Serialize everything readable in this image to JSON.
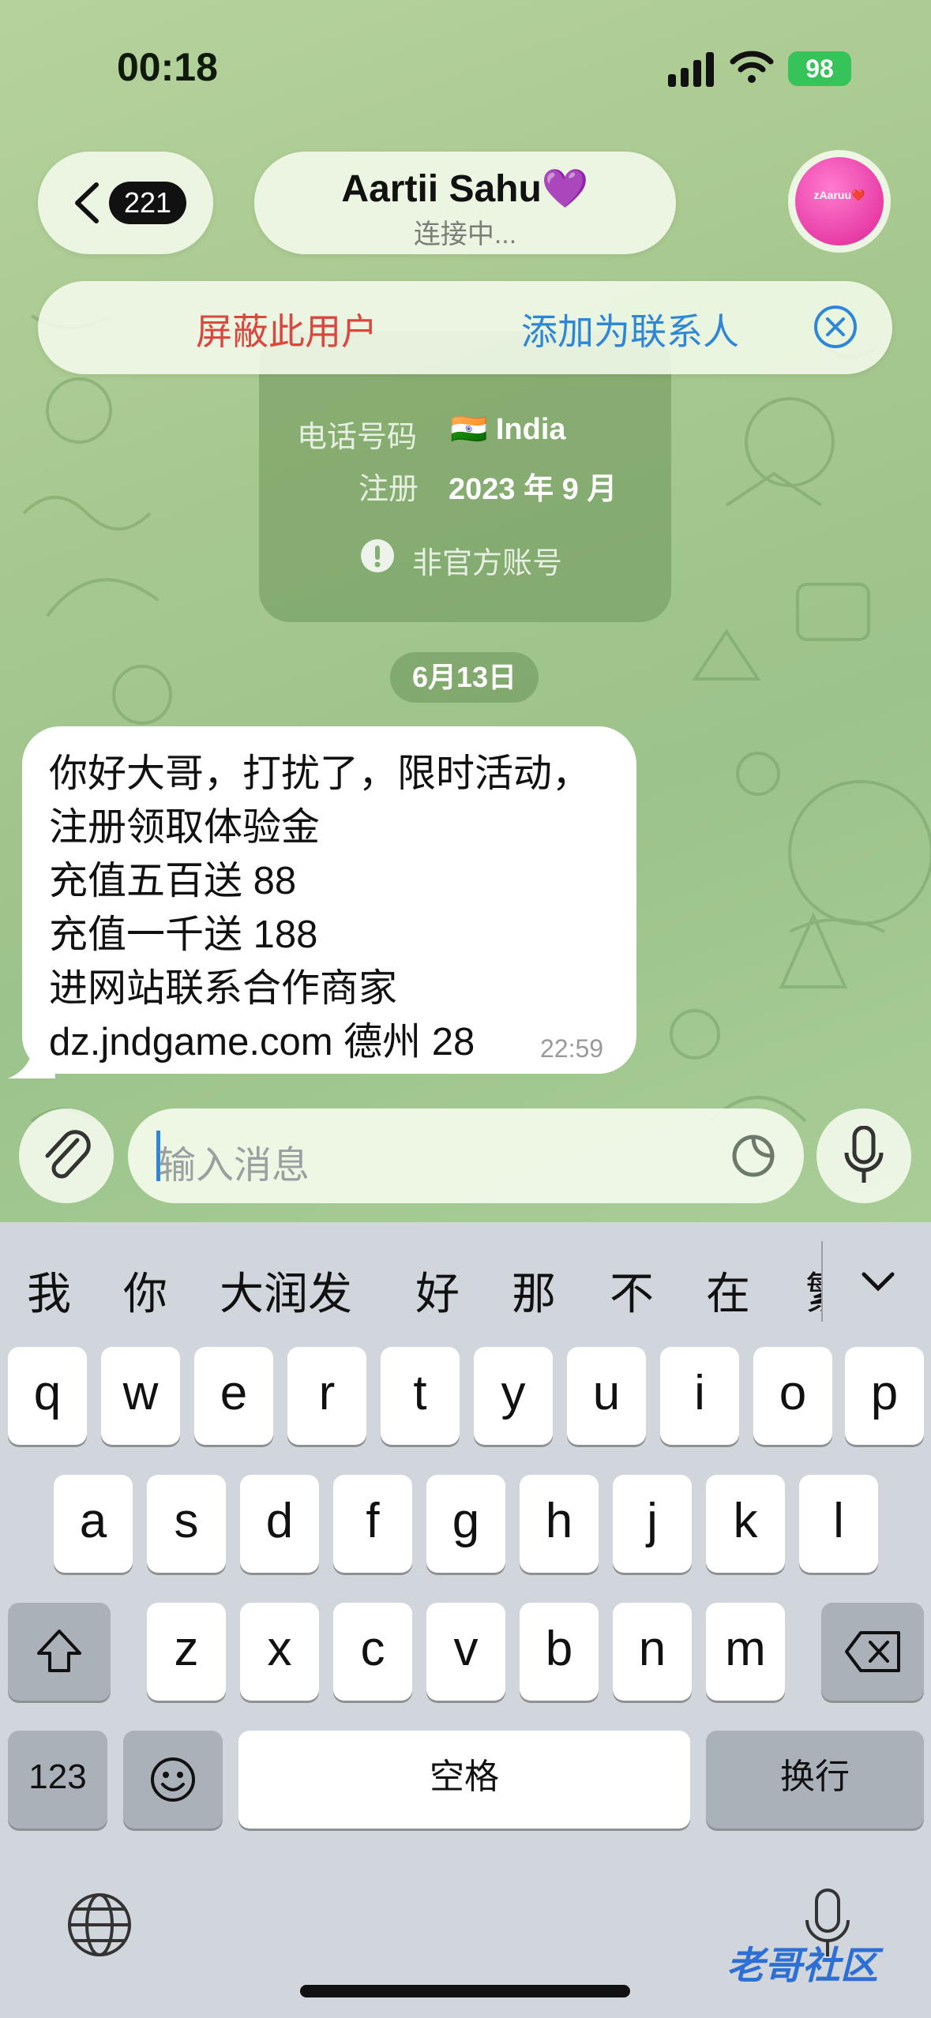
{
  "status_bar": {
    "time": "00:18",
    "battery": "98"
  },
  "header": {
    "back_count": "221",
    "title": "Aartii Sahu💜",
    "subtitle": "连接中...",
    "avatar_text": "zAaruu❤️"
  },
  "action_bar": {
    "block_label": "屏蔽此用户",
    "add_contact_label": "添加为联系人"
  },
  "info_card": {
    "phone_label": "电话号码",
    "phone_value": "🇮🇳 India",
    "registered_label": "注册",
    "registered_value": "2023 年 9 月",
    "unofficial_label": "非官方账号"
  },
  "date_chip": "6月13日",
  "message": {
    "lines": [
      "你好大哥，打扰了，限时活动，",
      "注册领取体验金",
      "充值五百送 88",
      "充值一千送 188",
      "进网站联系合作商家",
      " dz.jndgame.com 德州 28"
    ],
    "time": "22:59"
  },
  "input": {
    "placeholder": "输入消息"
  },
  "keyboard": {
    "candidates": [
      "我",
      "你",
      "大润发",
      "好",
      "那",
      "不",
      "在",
      "繁"
    ],
    "row1": [
      "q",
      "w",
      "e",
      "r",
      "t",
      "y",
      "u",
      "i",
      "o",
      "p"
    ],
    "row2": [
      "a",
      "s",
      "d",
      "f",
      "g",
      "h",
      "j",
      "k",
      "l"
    ],
    "row3": [
      "z",
      "x",
      "c",
      "v",
      "b",
      "n",
      "m"
    ],
    "num_key": "123",
    "space_key": "空格",
    "return_key": "换行"
  },
  "watermark": "老哥社区",
  "colors": {
    "block": "#d9473f",
    "add_contact": "#2f86d6",
    "battery": "#36c35a",
    "chat_bg": "#a7c98f"
  }
}
